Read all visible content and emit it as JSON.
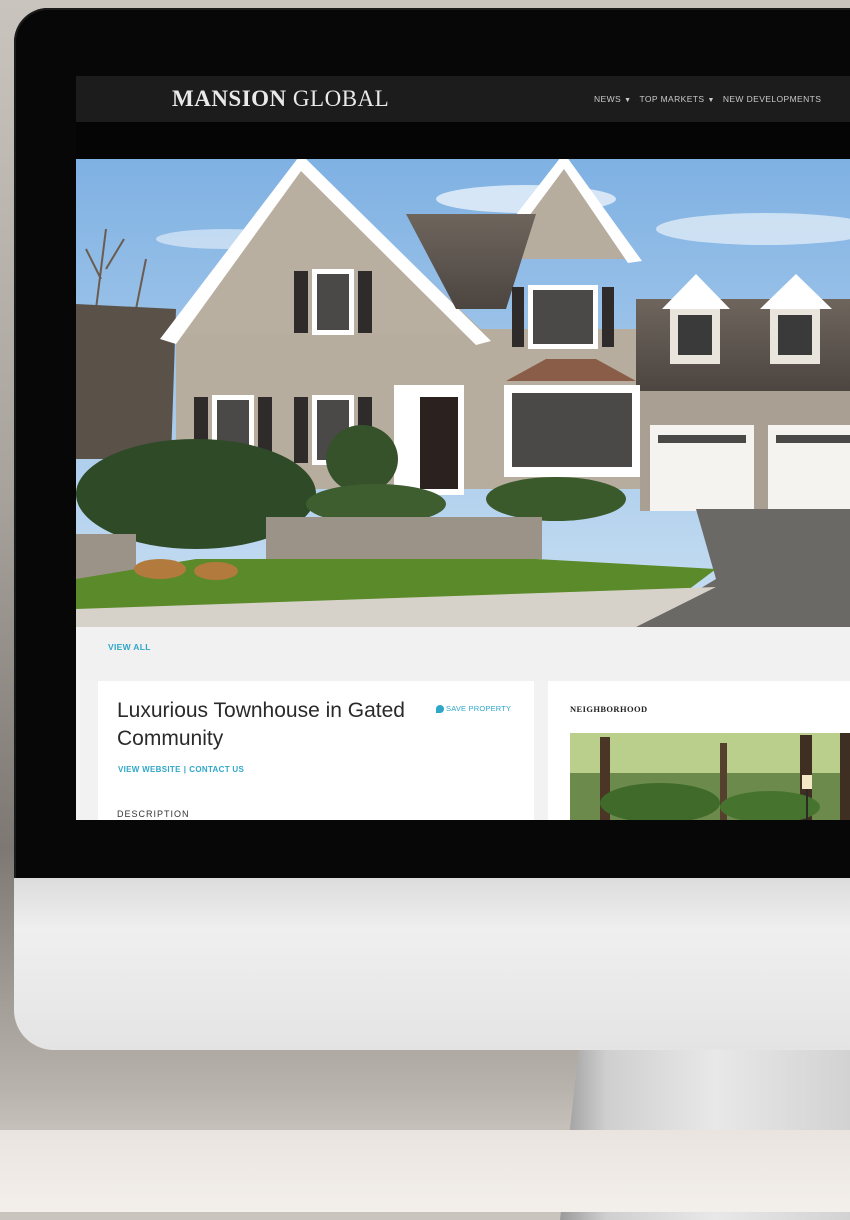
{
  "site": {
    "logo_bold": "MANSION",
    "logo_light": " GLOBAL"
  },
  "nav": {
    "items": [
      {
        "label": "NEWS",
        "has_caret": true
      },
      {
        "label": "TOP MARKETS",
        "has_caret": true
      },
      {
        "label": "NEW DEVELOPMENTS",
        "has_caret": false
      }
    ]
  },
  "hero": {
    "icon": "house-photo"
  },
  "listing": {
    "view_all": "VIEW ALL",
    "title": "Luxurious Townhouse in Gated Community",
    "save_label": "SAVE PROPERTY",
    "view_website": "VIEW WEBSITE",
    "separator": "|",
    "contact": "CONTACT US",
    "description_heading": "DESCRIPTION"
  },
  "neighborhood": {
    "heading": "NEIGHBORHOOD"
  },
  "colors": {
    "accent": "#2fa7c9",
    "nav_bg": "#1c1c1c"
  }
}
